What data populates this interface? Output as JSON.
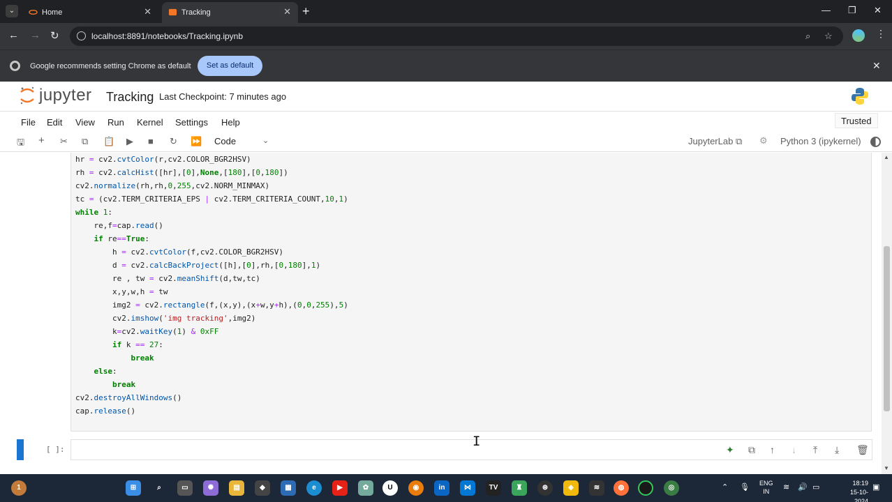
{
  "browser": {
    "tabs": [
      {
        "label": "Home",
        "active": false
      },
      {
        "label": "Tracking",
        "active": true
      }
    ],
    "url": "localhost:8891/notebooks/Tracking.ipynb",
    "infobar": {
      "message": "Google recommends setting Chrome as default",
      "button": "Set as default"
    }
  },
  "jupyter": {
    "logo_text": "jupyter",
    "notebook_name": "Tracking",
    "checkpoint": "Last Checkpoint: 7 minutes ago",
    "menu": [
      "File",
      "Edit",
      "View",
      "Run",
      "Kernel",
      "Settings",
      "Help"
    ],
    "trusted": "Trusted",
    "cell_type": "Code",
    "jupyterlab_link": "JupyterLab",
    "kernel": "Python 3 (ipykernel)",
    "empty_prompt": "[ ]:"
  },
  "code_lines": [
    "hr = cv2.cvtColor(r,cv2.COLOR_BGR2HSV)",
    "rh = cv2.calcHist([hr],[0],None,[180],[0,180])",
    "cv2.normalize(rh,rh,0,255,cv2.NORM_MINMAX)",
    "tc = (cv2.TERM_CRITERIA_EPS | cv2.TERM_CRITERIA_COUNT,10,1)",
    "while 1:",
    "    re,f=cap.read()",
    "    if re==True:",
    "        h = cv2.cvtColor(f,cv2.COLOR_BGR2HSV)",
    "        d = cv2.calcBackProject([h],[0],rh,[0,180],1)",
    "        re , tw = cv2.meanShift(d,tw,tc)",
    "        x,y,w,h = tw",
    "        img2 = cv2.rectangle(f,(x,y),(x+w,y+h),(0,0,255),5)",
    "        cv2.imshow('img tracking',img2)",
    "        k=cv2.waitKey(1) & 0xFF",
    "        if k == 27:",
    "            break",
    "    else:",
    "        break",
    "cv2.destroyAllWindows()",
    "cap.release()"
  ],
  "taskbar": {
    "language": [
      "ENG",
      "IN"
    ],
    "time": "18:19",
    "date": "15-10-2024"
  },
  "colors": {
    "accent": "#1976d2",
    "chrome_dark": "#202124",
    "taskbar": "#1c2838"
  }
}
